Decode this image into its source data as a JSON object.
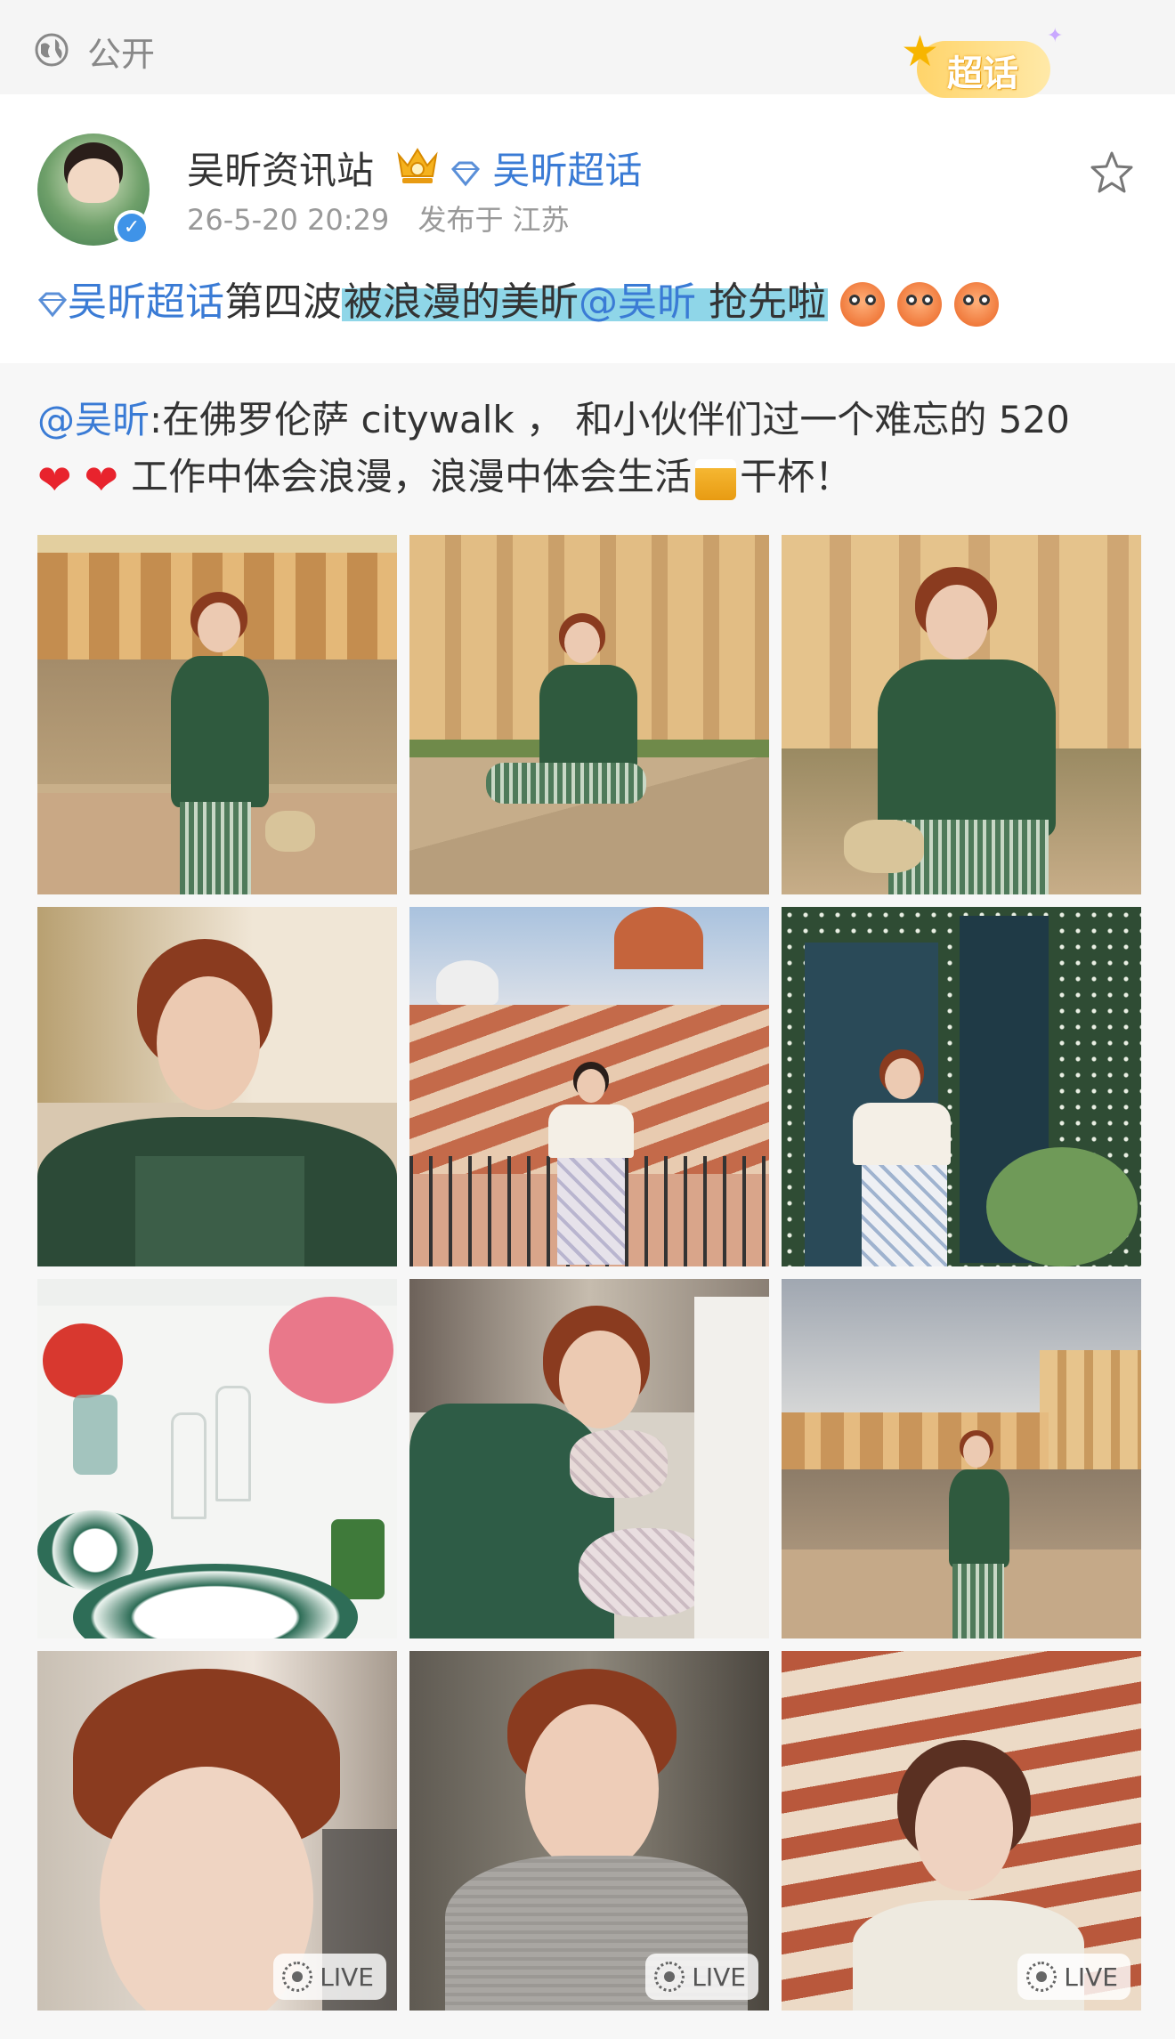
{
  "topbar": {
    "label": "公开",
    "badge_label": "超话"
  },
  "user": {
    "name": "吴昕资讯站",
    "topic_link": "吴昕超话",
    "timestamp": "26-5-20 20:29",
    "location": "发布于 江苏"
  },
  "post": {
    "topic": "吴昕超话",
    "text_plain": "第四波",
    "highlight_a": "被浪漫的美昕",
    "mention": "@吴昕",
    "highlight_b": "抢先啦"
  },
  "repost": {
    "mention": "@吴昕",
    "line1_text": ":在佛罗伦萨 citywalk ， 和小伙伴们过一个难忘的 520",
    "line2_text_a": "工作中体会浪漫，浪漫中体会生活",
    "line2_text_b": "干杯！"
  },
  "photos": {
    "live_label": "LIVE",
    "items": [
      {
        "scene": "bridge-river",
        "live": false
      },
      {
        "scene": "building-sitting",
        "live": false
      },
      {
        "scene": "building-closeup",
        "live": false
      },
      {
        "scene": "portrait-green-jacket",
        "live": false
      },
      {
        "scene": "rooftop-duomo",
        "live": false
      },
      {
        "scene": "garden-doorway",
        "live": false
      },
      {
        "scene": "dinner-table",
        "live": false
      },
      {
        "scene": "party-handbag",
        "live": false
      },
      {
        "scene": "bridge-walking",
        "live": false
      },
      {
        "scene": "closeup-face",
        "live": true
      },
      {
        "scene": "selfie-cardigan",
        "live": true
      },
      {
        "scene": "rooftops-portrait",
        "live": true
      }
    ]
  },
  "colors": {
    "link": "#3a7bd5",
    "highlight": "#8fd6e8",
    "meta": "#999999"
  }
}
